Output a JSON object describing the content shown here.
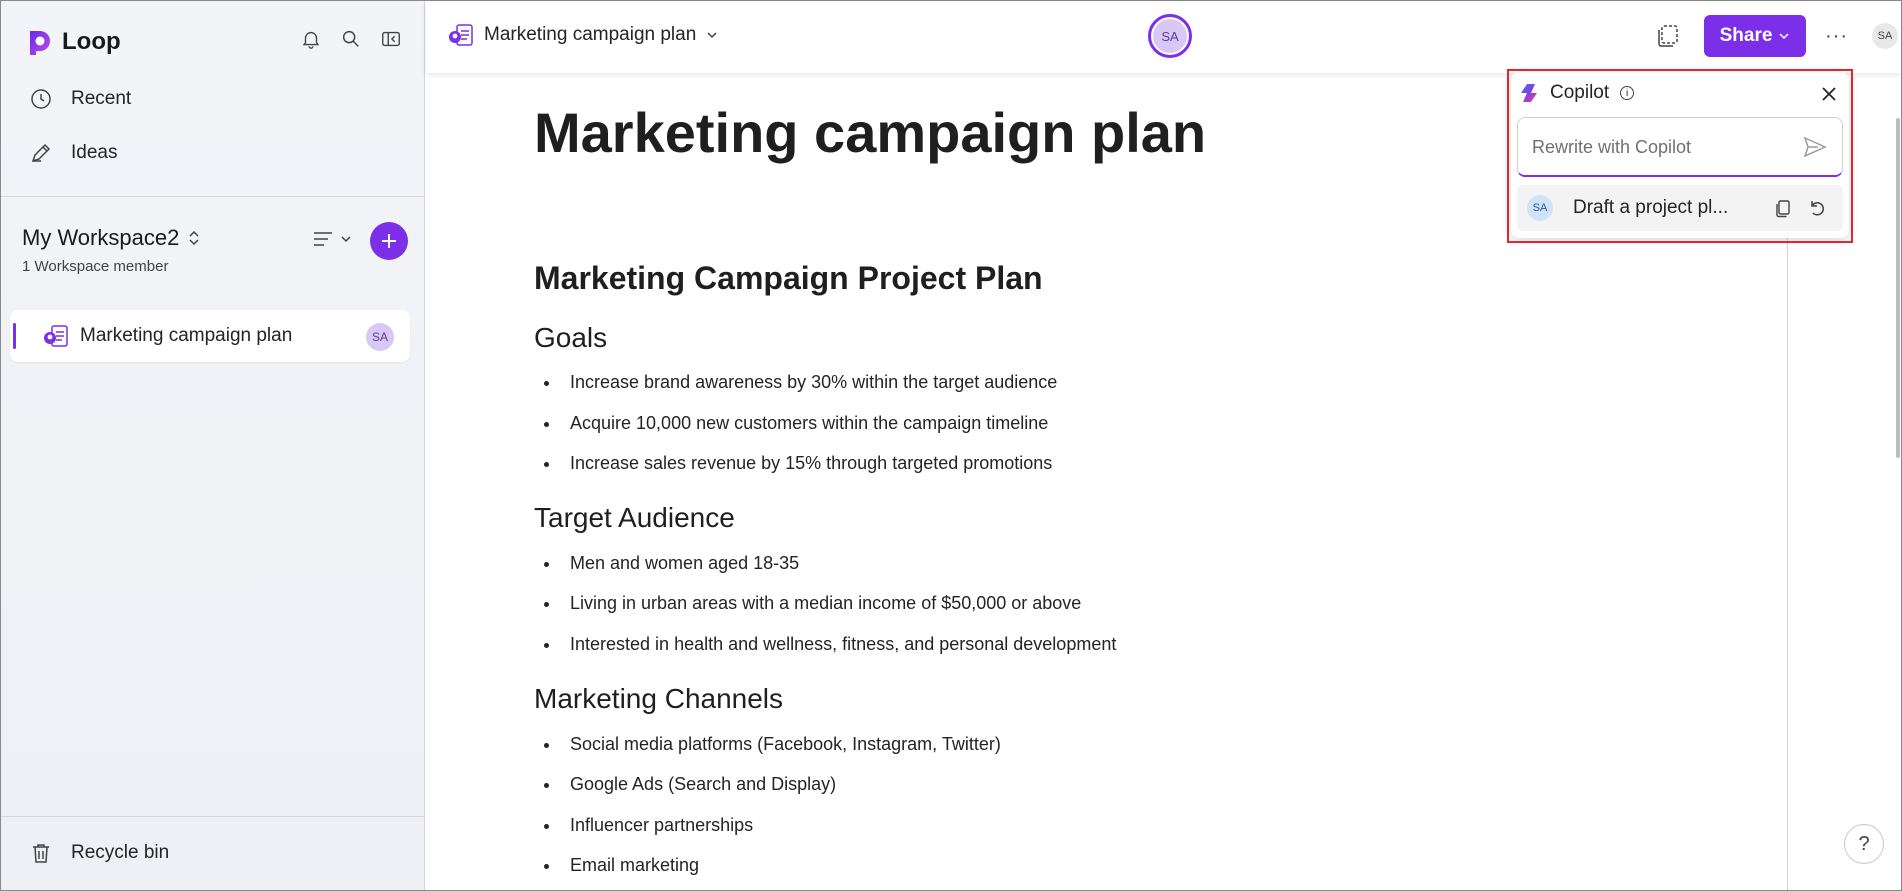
{
  "app": {
    "name": "Loop"
  },
  "sidebar": {
    "nav": [
      {
        "label": "Recent",
        "icon": "clock-icon"
      },
      {
        "label": "Ideas",
        "icon": "pen-icon"
      }
    ],
    "workspace": {
      "title": "My Workspace2",
      "subtitle": "1 Workspace member"
    },
    "pages": [
      {
        "label": "Marketing campaign plan",
        "avatar": "SA"
      }
    ],
    "recycle_bin": "Recycle bin"
  },
  "header": {
    "doc_title": "Marketing campaign plan",
    "center_avatar": "SA",
    "share_label": "Share",
    "user_initials": "SA"
  },
  "document": {
    "title": "Marketing campaign plan",
    "heading": "Marketing Campaign Project Plan",
    "sections": [
      {
        "title": "Goals",
        "items": [
          "Increase brand awareness by 30% within the target audience",
          "Acquire 10,000 new customers within the campaign timeline",
          "Increase sales revenue by 15% through targeted promotions"
        ]
      },
      {
        "title": "Target Audience",
        "items": [
          "Men and women aged 18-35",
          "Living in urban areas with a median income of $50,000 or above",
          "Interested in health and wellness, fitness, and personal development"
        ]
      },
      {
        "title": "Marketing Channels",
        "items": [
          "Social media platforms (Facebook, Instagram, Twitter)",
          "Google Ads (Search and Display)",
          "Influencer partnerships",
          "Email marketing"
        ]
      }
    ]
  },
  "copilot": {
    "title": "Copilot",
    "input_placeholder": "Rewrite with Copilot",
    "history_item": {
      "avatar": "SA",
      "text": "Draft a project pl..."
    }
  },
  "help_label": "?",
  "colors": {
    "accent": "#7b2fe8",
    "highlight_outline": "#e0262f"
  }
}
